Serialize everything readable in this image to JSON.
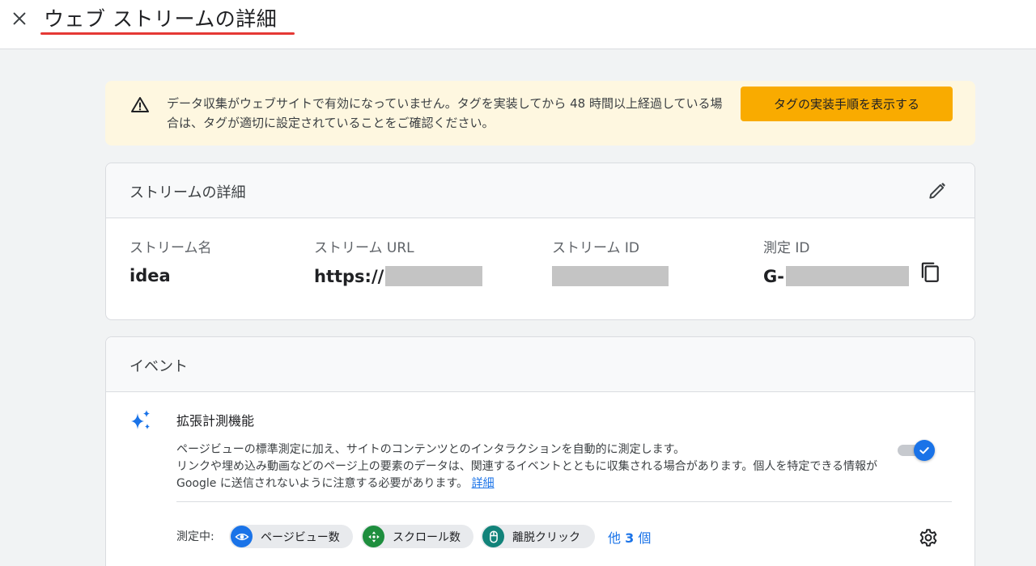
{
  "header": {
    "close_label": "×",
    "title": "ウェブ ストリームの詳細",
    "underline_color": "#e53935"
  },
  "banner": {
    "icon": "warning-icon",
    "text": "データ収集がウェブサイトで有効になっていません。タグを実装してから 48 時間以上経過している場合は、タグが適切に設定されていることをご確認ください。",
    "button_label": "タグの実装手順を表示する",
    "button_color": "#f9ab00"
  },
  "stream_details": {
    "title": "ストリームの詳細",
    "edit_icon": "pencil-icon",
    "copy_icon": "copy-icon",
    "fields": [
      {
        "label": "ストリーム名",
        "value": "idea"
      },
      {
        "label": "ストリーム URL",
        "value": "https://"
      },
      {
        "label": "ストリーム ID",
        "value": ""
      },
      {
        "label": "測定 ID",
        "value": "G-"
      }
    ]
  },
  "events": {
    "title": "イベント",
    "enhanced": {
      "icon": "sparkle-icon",
      "title": "拡張計測機能",
      "desc_line1": "ページビューの標準測定に加え、サイトのコンテンツとのインタラクションを自動的に測定します。",
      "desc_line2": "リンクや埋め込み動画などのページ上の要素のデータは、関連するイベントとともに収集される場合があります。個人を特定できる情報が Google に送信されないように注意する必要があります。",
      "details_link": "詳細",
      "toggle_on": true
    },
    "measuring_label": "測定中:",
    "chips": [
      {
        "label": "ページビュー数",
        "icon": "eye-icon",
        "color": "#1a73e8"
      },
      {
        "label": "スクロール数",
        "icon": "move-icon",
        "color": "#1e8e3e"
      },
      {
        "label": "離脱クリック",
        "icon": "mouse-icon",
        "color": "#12837a"
      }
    ],
    "more_prefix": "他",
    "more_count": "3",
    "more_suffix": "個",
    "settings_icon": "gear-icon"
  }
}
